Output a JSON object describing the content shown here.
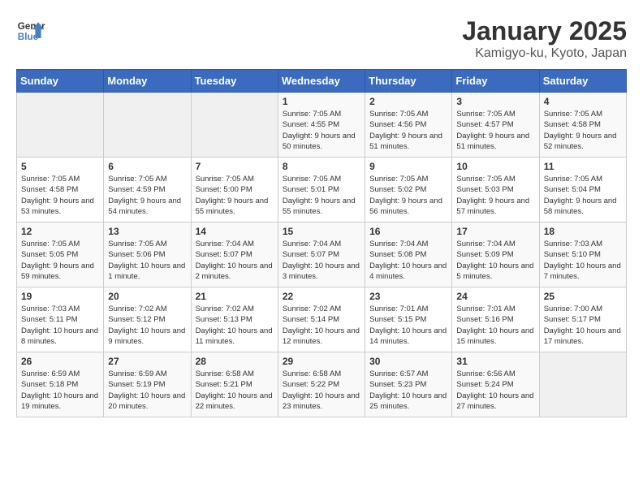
{
  "header": {
    "logo_line1": "General",
    "logo_line2": "Blue",
    "title": "January 2025",
    "subtitle": "Kamigyo-ku, Kyoto, Japan"
  },
  "weekdays": [
    "Sunday",
    "Monday",
    "Tuesday",
    "Wednesday",
    "Thursday",
    "Friday",
    "Saturday"
  ],
  "weeks": [
    [
      {
        "day": "",
        "sunrise": "",
        "sunset": "",
        "daylight": "",
        "empty": true
      },
      {
        "day": "",
        "sunrise": "",
        "sunset": "",
        "daylight": "",
        "empty": true
      },
      {
        "day": "",
        "sunrise": "",
        "sunset": "",
        "daylight": "",
        "empty": true
      },
      {
        "day": "1",
        "sunrise": "Sunrise: 7:05 AM",
        "sunset": "Sunset: 4:55 PM",
        "daylight": "Daylight: 9 hours and 50 minutes."
      },
      {
        "day": "2",
        "sunrise": "Sunrise: 7:05 AM",
        "sunset": "Sunset: 4:56 PM",
        "daylight": "Daylight: 9 hours and 51 minutes."
      },
      {
        "day": "3",
        "sunrise": "Sunrise: 7:05 AM",
        "sunset": "Sunset: 4:57 PM",
        "daylight": "Daylight: 9 hours and 51 minutes."
      },
      {
        "day": "4",
        "sunrise": "Sunrise: 7:05 AM",
        "sunset": "Sunset: 4:58 PM",
        "daylight": "Daylight: 9 hours and 52 minutes."
      }
    ],
    [
      {
        "day": "5",
        "sunrise": "Sunrise: 7:05 AM",
        "sunset": "Sunset: 4:58 PM",
        "daylight": "Daylight: 9 hours and 53 minutes."
      },
      {
        "day": "6",
        "sunrise": "Sunrise: 7:05 AM",
        "sunset": "Sunset: 4:59 PM",
        "daylight": "Daylight: 9 hours and 54 minutes."
      },
      {
        "day": "7",
        "sunrise": "Sunrise: 7:05 AM",
        "sunset": "Sunset: 5:00 PM",
        "daylight": "Daylight: 9 hours and 55 minutes."
      },
      {
        "day": "8",
        "sunrise": "Sunrise: 7:05 AM",
        "sunset": "Sunset: 5:01 PM",
        "daylight": "Daylight: 9 hours and 55 minutes."
      },
      {
        "day": "9",
        "sunrise": "Sunrise: 7:05 AM",
        "sunset": "Sunset: 5:02 PM",
        "daylight": "Daylight: 9 hours and 56 minutes."
      },
      {
        "day": "10",
        "sunrise": "Sunrise: 7:05 AM",
        "sunset": "Sunset: 5:03 PM",
        "daylight": "Daylight: 9 hours and 57 minutes."
      },
      {
        "day": "11",
        "sunrise": "Sunrise: 7:05 AM",
        "sunset": "Sunset: 5:04 PM",
        "daylight": "Daylight: 9 hours and 58 minutes."
      }
    ],
    [
      {
        "day": "12",
        "sunrise": "Sunrise: 7:05 AM",
        "sunset": "Sunset: 5:05 PM",
        "daylight": "Daylight: 9 hours and 59 minutes."
      },
      {
        "day": "13",
        "sunrise": "Sunrise: 7:05 AM",
        "sunset": "Sunset: 5:06 PM",
        "daylight": "Daylight: 10 hours and 1 minute."
      },
      {
        "day": "14",
        "sunrise": "Sunrise: 7:04 AM",
        "sunset": "Sunset: 5:07 PM",
        "daylight": "Daylight: 10 hours and 2 minutes."
      },
      {
        "day": "15",
        "sunrise": "Sunrise: 7:04 AM",
        "sunset": "Sunset: 5:07 PM",
        "daylight": "Daylight: 10 hours and 3 minutes."
      },
      {
        "day": "16",
        "sunrise": "Sunrise: 7:04 AM",
        "sunset": "Sunset: 5:08 PM",
        "daylight": "Daylight: 10 hours and 4 minutes."
      },
      {
        "day": "17",
        "sunrise": "Sunrise: 7:04 AM",
        "sunset": "Sunset: 5:09 PM",
        "daylight": "Daylight: 10 hours and 5 minutes."
      },
      {
        "day": "18",
        "sunrise": "Sunrise: 7:03 AM",
        "sunset": "Sunset: 5:10 PM",
        "daylight": "Daylight: 10 hours and 7 minutes."
      }
    ],
    [
      {
        "day": "19",
        "sunrise": "Sunrise: 7:03 AM",
        "sunset": "Sunset: 5:11 PM",
        "daylight": "Daylight: 10 hours and 8 minutes."
      },
      {
        "day": "20",
        "sunrise": "Sunrise: 7:02 AM",
        "sunset": "Sunset: 5:12 PM",
        "daylight": "Daylight: 10 hours and 9 minutes."
      },
      {
        "day": "21",
        "sunrise": "Sunrise: 7:02 AM",
        "sunset": "Sunset: 5:13 PM",
        "daylight": "Daylight: 10 hours and 11 minutes."
      },
      {
        "day": "22",
        "sunrise": "Sunrise: 7:02 AM",
        "sunset": "Sunset: 5:14 PM",
        "daylight": "Daylight: 10 hours and 12 minutes."
      },
      {
        "day": "23",
        "sunrise": "Sunrise: 7:01 AM",
        "sunset": "Sunset: 5:15 PM",
        "daylight": "Daylight: 10 hours and 14 minutes."
      },
      {
        "day": "24",
        "sunrise": "Sunrise: 7:01 AM",
        "sunset": "Sunset: 5:16 PM",
        "daylight": "Daylight: 10 hours and 15 minutes."
      },
      {
        "day": "25",
        "sunrise": "Sunrise: 7:00 AM",
        "sunset": "Sunset: 5:17 PM",
        "daylight": "Daylight: 10 hours and 17 minutes."
      }
    ],
    [
      {
        "day": "26",
        "sunrise": "Sunrise: 6:59 AM",
        "sunset": "Sunset: 5:18 PM",
        "daylight": "Daylight: 10 hours and 19 minutes."
      },
      {
        "day": "27",
        "sunrise": "Sunrise: 6:59 AM",
        "sunset": "Sunset: 5:19 PM",
        "daylight": "Daylight: 10 hours and 20 minutes."
      },
      {
        "day": "28",
        "sunrise": "Sunrise: 6:58 AM",
        "sunset": "Sunset: 5:21 PM",
        "daylight": "Daylight: 10 hours and 22 minutes."
      },
      {
        "day": "29",
        "sunrise": "Sunrise: 6:58 AM",
        "sunset": "Sunset: 5:22 PM",
        "daylight": "Daylight: 10 hours and 23 minutes."
      },
      {
        "day": "30",
        "sunrise": "Sunrise: 6:57 AM",
        "sunset": "Sunset: 5:23 PM",
        "daylight": "Daylight: 10 hours and 25 minutes."
      },
      {
        "day": "31",
        "sunrise": "Sunrise: 6:56 AM",
        "sunset": "Sunset: 5:24 PM",
        "daylight": "Daylight: 10 hours and 27 minutes."
      },
      {
        "day": "",
        "sunrise": "",
        "sunset": "",
        "daylight": "",
        "empty": true
      }
    ]
  ]
}
